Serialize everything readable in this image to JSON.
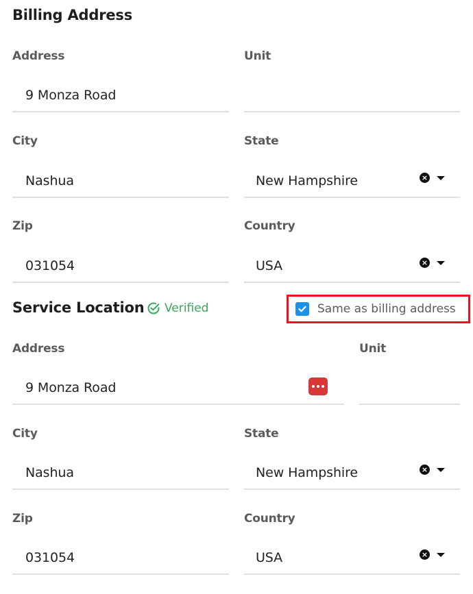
{
  "billing": {
    "title": "Billing Address",
    "address_label": "Address",
    "address_value": "9 Monza Road",
    "unit_label": "Unit",
    "unit_value": "",
    "city_label": "City",
    "city_value": "Nashua",
    "state_label": "State",
    "state_value": "New Hampshire",
    "zip_label": "Zip",
    "zip_value": "031054",
    "country_label": "Country",
    "country_value": "USA"
  },
  "service": {
    "title": "Service Location",
    "verified_text": "Verified",
    "same_as_billing_label": "Same as billing address",
    "same_as_billing_checked": true,
    "address_label": "Address",
    "address_value": "9 Monza Road",
    "unit_label": "Unit",
    "unit_value": "",
    "city_label": "City",
    "city_value": "Nashua",
    "state_label": "State",
    "state_value": "New Hampshire",
    "zip_label": "Zip",
    "zip_value": "031054",
    "country_label": "Country",
    "country_value": "USA"
  },
  "colors": {
    "verified_green": "#3aa65a",
    "checkbox_blue": "#1e90e6",
    "highlight_red": "#e8141c",
    "more_button_red": "#d93838"
  },
  "icons": [
    "check-circle-icon",
    "clear-icon",
    "caret-down-icon",
    "checkbox-checked-icon",
    "more-horizontal-icon"
  ]
}
